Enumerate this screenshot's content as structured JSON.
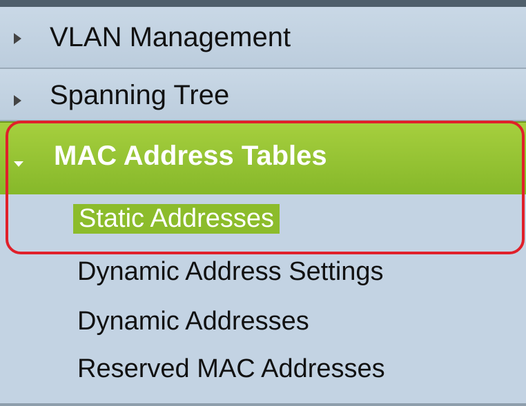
{
  "menu": {
    "sections": [
      {
        "label": "VLAN Management",
        "state": "collapsed"
      },
      {
        "label": "Spanning Tree",
        "state": "collapsed"
      },
      {
        "label": "MAC Address Tables",
        "state": "expanded"
      }
    ],
    "submenu": [
      {
        "label": "Static Addresses",
        "selected": true
      },
      {
        "label": "Dynamic Address Settings",
        "selected": false
      },
      {
        "label": "Dynamic Addresses",
        "selected": false
      },
      {
        "label": "Reserved MAC Addresses",
        "selected": false
      }
    ]
  },
  "colors": {
    "active_section": "#94c233",
    "selected_item": "#8cbc2b",
    "menu_background": "#c3d3e3",
    "highlight_ring": "#e0202a"
  }
}
